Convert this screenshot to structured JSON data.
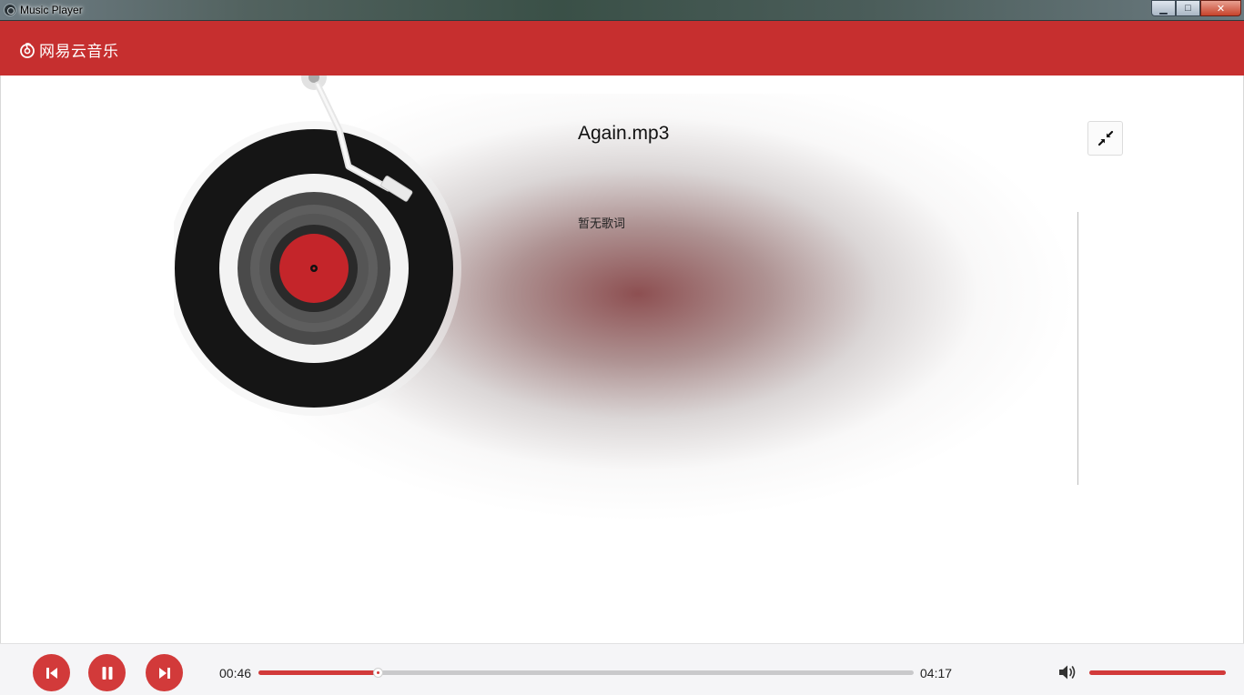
{
  "window": {
    "title": "Music Player",
    "buttons": {
      "minimize": "▁",
      "maximize": "□",
      "close": "✕"
    }
  },
  "header": {
    "logo_text": "网易云音乐",
    "logo_icon": "netease-music-icon",
    "brand_color": "#c62f2f"
  },
  "player_view": {
    "song_title": "Again.mp3",
    "lyrics_placeholder": "暂无歌词",
    "shrink_icon": "shrink-arrows-icon"
  },
  "controls": {
    "current_time": "00:46",
    "total_time": "04:17",
    "progress_fraction": 0.182,
    "volume_fraction": 1.0,
    "accent_color": "#d23a3a",
    "icons": {
      "prev": "skip-previous-icon",
      "pause": "pause-icon",
      "next": "skip-next-icon",
      "volume": "speaker-icon"
    }
  }
}
